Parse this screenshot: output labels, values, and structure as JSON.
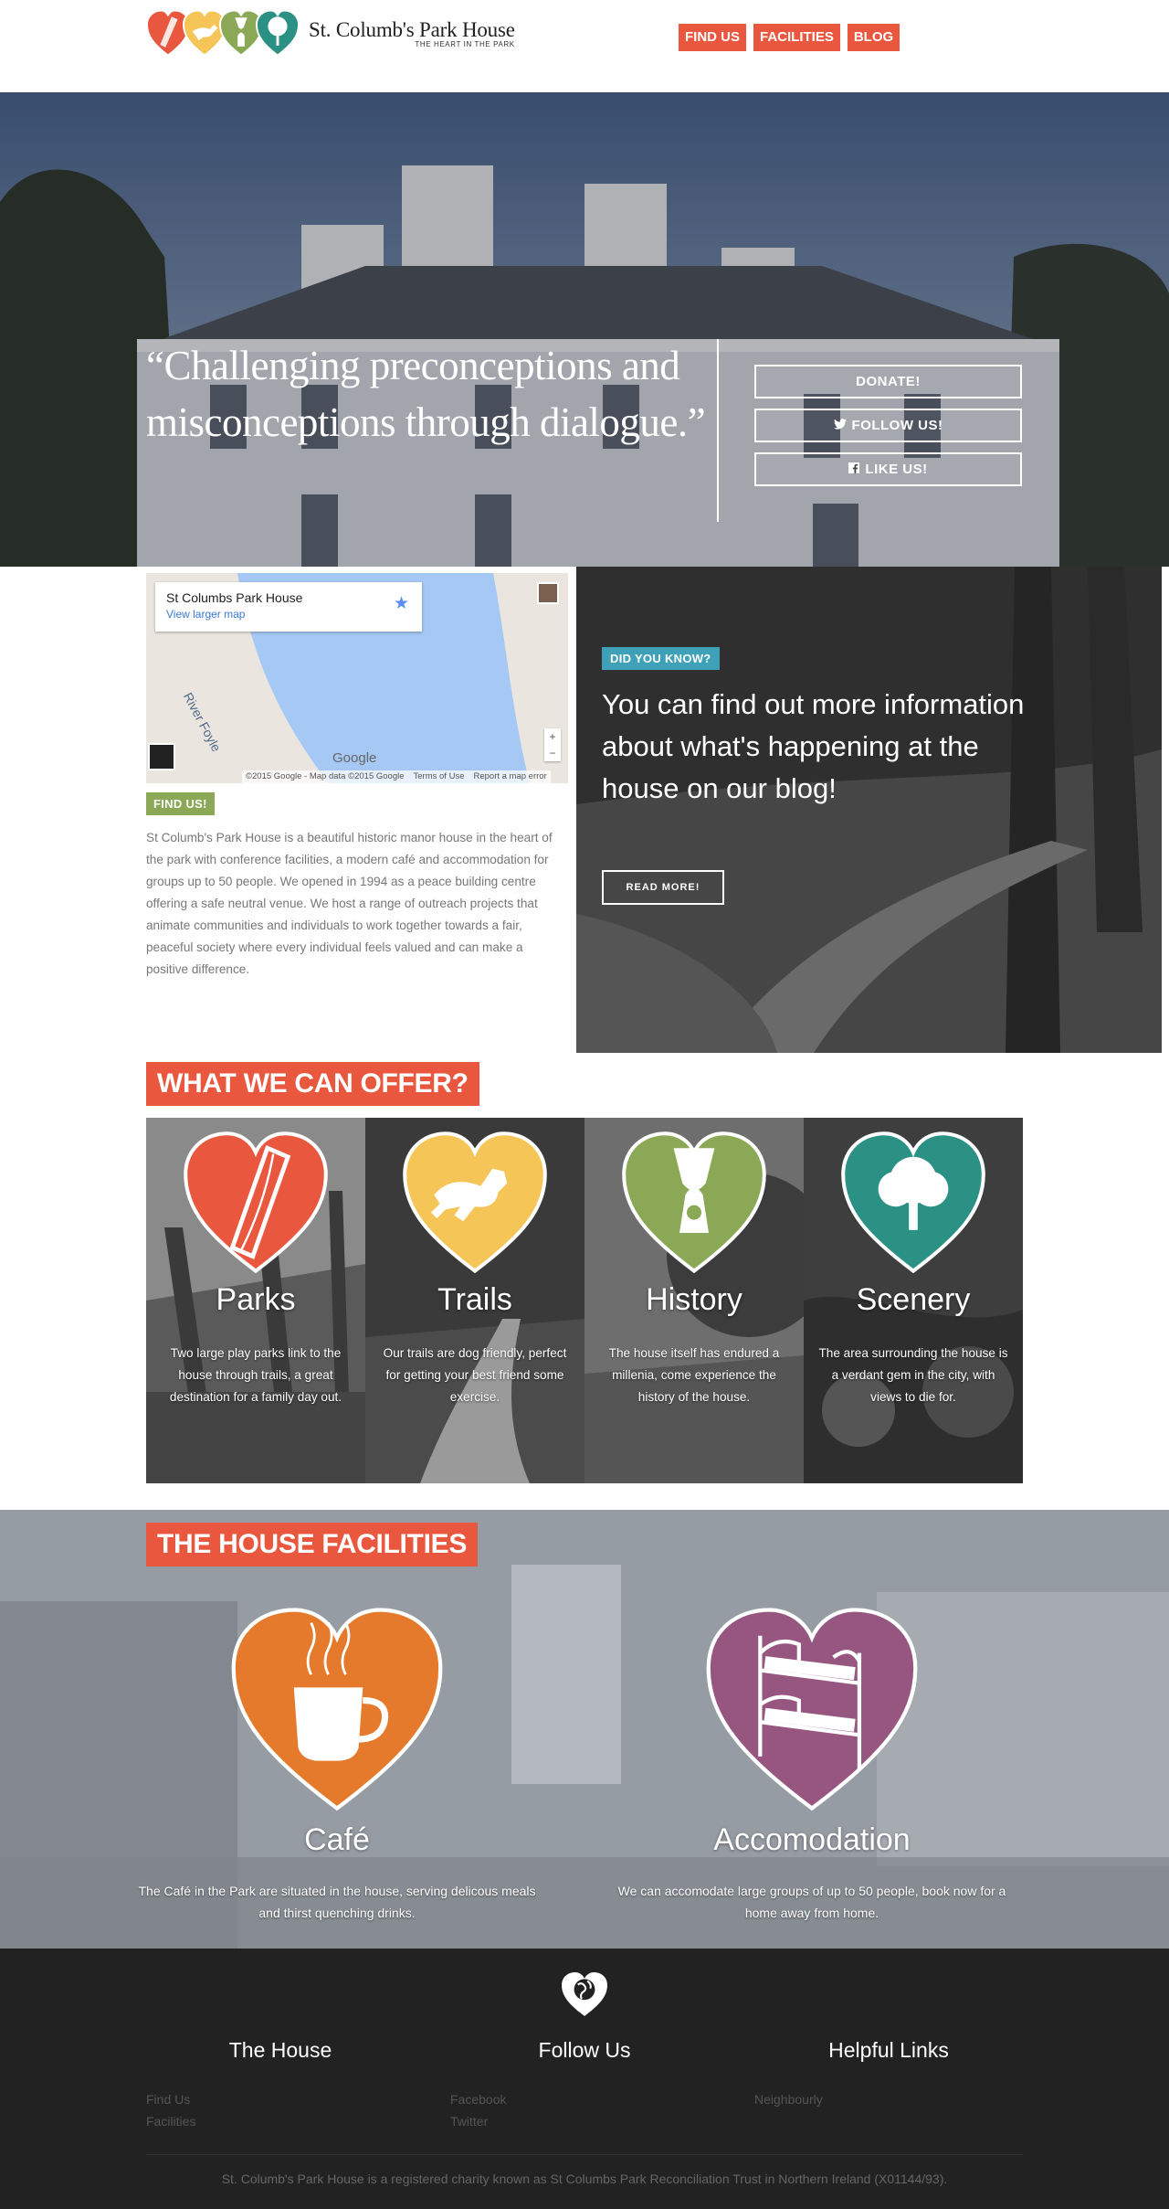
{
  "header": {
    "logo_title": "St. Columb's Park House",
    "logo_tagline": "THE HEART IN THE PARK",
    "nav": [
      "FIND US",
      "FACILITIES",
      "BLOG"
    ]
  },
  "hero": {
    "quote": "“Challenging preconceptions and misconceptions through dialogue.”",
    "buttons": [
      "DONATE!",
      "FOLLOW US!",
      "LIKE US!"
    ]
  },
  "map": {
    "card_title": "St Columbs Park House",
    "card_link": "View larger map",
    "river_label": "River Foyle",
    "google_label": "Google",
    "attribution": [
      "©2015 Google - Map data ©2015 Google",
      "Terms of Use",
      "Report a map error"
    ],
    "zoom_in": "+",
    "zoom_out": "−"
  },
  "findus": {
    "label": "FIND US!",
    "text": "St Columb's Park House is a beautiful historic manor house in the heart of the park with conference facilities, a modern café and accommodation for groups up to 50 people. We opened in 1994 as a peace building centre offering a safe neutral venue. We host a range of outreach projects that animate communities and individuals to work together towards a fair, peaceful society where every individual feels valued and can make a positive difference."
  },
  "did_you_know": {
    "label": "DID YOU KNOW?",
    "text": "You can find out more information about what's happening at the house on our blog!",
    "button": "READ MORE!"
  },
  "offer": {
    "title": "WHAT WE CAN OFFER?",
    "cards": [
      {
        "title": "Parks",
        "desc": "Two large play parks link to the house through trails, a great destination for a family day out.",
        "color": "#e9573f",
        "icon": "slide-icon"
      },
      {
        "title": "Trails",
        "desc": "Our trails are dog friendly, perfect for getting your best friend some exercise.",
        "color": "#f6c558",
        "icon": "dog-icon"
      },
      {
        "title": "History",
        "desc": "The house itself has endured a millenia, come experience the history of the house.",
        "color": "#8aa855",
        "icon": "history-figure-icon"
      },
      {
        "title": "Scenery",
        "desc": "The area surrounding the house is a verdant gem in the city, with views to die for.",
        "color": "#2a9184",
        "icon": "tree-icon"
      }
    ]
  },
  "facilities": {
    "title": "THE HOUSE FACILITIES",
    "items": [
      {
        "title": "Café",
        "desc": "The Café in the Park are situated in the house, serving delicous meals and thirst quenching drinks.",
        "color": "#e57a2c",
        "icon": "coffee-cup-icon"
      },
      {
        "title": "Accomodation",
        "desc": "We can accomodate large groups of up to 50 people, book now for a home away from home.",
        "color": "#965680",
        "icon": "bunk-bed-icon"
      }
    ]
  },
  "footer": {
    "columns": [
      {
        "title": "The House",
        "links": [
          "Find Us",
          "Facilities"
        ]
      },
      {
        "title": "Follow Us",
        "links": [
          "Facebook",
          "Twitter"
        ]
      },
      {
        "title": "Helpful Links",
        "links": [
          "Neighbourly"
        ]
      }
    ],
    "note": "St. Columb's Park House is a registered charity known as St Columbs Park Reconciliation Trust in Northern Ireland (X01144/93)."
  }
}
